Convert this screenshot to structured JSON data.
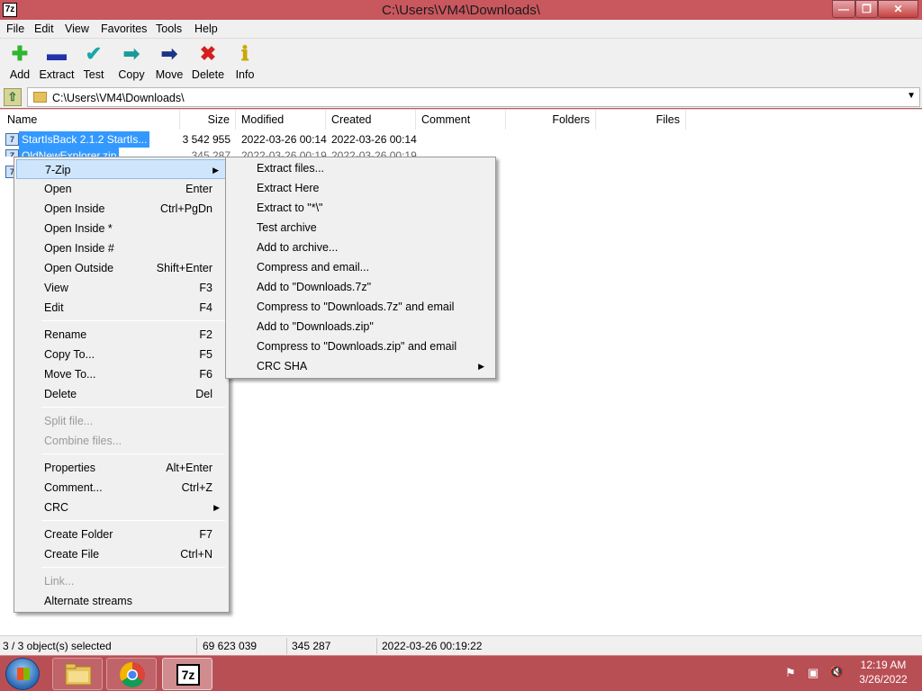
{
  "window": {
    "icon_label": "7z",
    "title": "C:\\Users\\VM4\\Downloads\\",
    "min_icon": "minimize-icon",
    "max_icon": "restore-icon",
    "close_icon": "close-icon",
    "min_glyph": "—",
    "max_glyph": "❐",
    "close_glyph": "✕"
  },
  "menubar": [
    "File",
    "Edit",
    "View",
    "Favorites",
    "Tools",
    "Help"
  ],
  "toolbar": [
    {
      "label": "Add",
      "icon": "plus-icon",
      "glyph": "✚",
      "color": "#2fb52f"
    },
    {
      "label": "Extract",
      "icon": "minus-icon",
      "glyph": "▬",
      "color": "#2233aa"
    },
    {
      "label": "Test",
      "icon": "check-icon",
      "glyph": "✔",
      "color": "#1aa7a7"
    },
    {
      "label": "Copy",
      "icon": "copy-arrow-icon",
      "glyph": "➡",
      "color": "#1a9a9a"
    },
    {
      "label": "Move",
      "icon": "move-arrow-icon",
      "glyph": "➡",
      "color": "#1a3488"
    },
    {
      "label": "Delete",
      "icon": "delete-x-icon",
      "glyph": "✖",
      "color": "#d42020"
    },
    {
      "label": "Info",
      "icon": "info-icon",
      "glyph": "ℹ",
      "color": "#c8a800"
    }
  ],
  "address": {
    "path": "C:\\Users\\VM4\\Downloads\\",
    "up_glyph": "⇧",
    "drop_glyph": "▼"
  },
  "columns": [
    "Name",
    "Size",
    "Modified",
    "Created",
    "Comment",
    "Folders",
    "Files"
  ],
  "files": [
    {
      "name": "StartIsBack 2.1.2  StartIs...",
      "size": "3 542 955",
      "modified": "2022-03-26 00:14",
      "created": "2022-03-26 00:14",
      "icon": "7z-archive-icon",
      "icon_glyph": "7"
    },
    {
      "name": "OldNewExplorer.zip",
      "size": "345 287",
      "modified": "2022-03-26 00:19",
      "created": "2022-03-26 00:19",
      "icon": "zip-archive-icon",
      "icon_glyph": "Z"
    },
    {
      "name": "",
      "size": "",
      "modified": "",
      "created": "",
      "icon": "archive-icon",
      "icon_glyph": "7"
    }
  ],
  "context_menu": {
    "items": [
      {
        "label": "7-Zip",
        "key": "",
        "submenu": true,
        "highlight": true
      },
      {
        "label": "Open",
        "key": "Enter"
      },
      {
        "label": "Open Inside",
        "key": "Ctrl+PgDn"
      },
      {
        "label": "Open Inside *",
        "key": ""
      },
      {
        "label": "Open Inside #",
        "key": ""
      },
      {
        "label": "Open Outside",
        "key": "Shift+Enter"
      },
      {
        "label": "View",
        "key": "F3"
      },
      {
        "label": "Edit",
        "key": "F4"
      },
      {
        "sep": true
      },
      {
        "label": "Rename",
        "key": "F2"
      },
      {
        "label": "Copy To...",
        "key": "F5"
      },
      {
        "label": "Move To...",
        "key": "F6"
      },
      {
        "label": "Delete",
        "key": "Del"
      },
      {
        "sep": true
      },
      {
        "label": "Split file...",
        "key": "",
        "disabled": true
      },
      {
        "label": "Combine files...",
        "key": "",
        "disabled": true
      },
      {
        "sep": true
      },
      {
        "label": "Properties",
        "key": "Alt+Enter"
      },
      {
        "label": "Comment...",
        "key": "Ctrl+Z"
      },
      {
        "label": "CRC",
        "key": "",
        "submenu": true
      },
      {
        "sep": true
      },
      {
        "label": "Create Folder",
        "key": "F7"
      },
      {
        "label": "Create File",
        "key": "Ctrl+N"
      },
      {
        "sep": true
      },
      {
        "label": "Link...",
        "key": "",
        "disabled": true
      },
      {
        "label": "Alternate streams",
        "key": ""
      }
    ],
    "submenu_glyph": "▶"
  },
  "submenu": [
    {
      "label": "Extract files..."
    },
    {
      "label": "Extract Here"
    },
    {
      "label": "Extract to \"*\\\""
    },
    {
      "label": "Test archive"
    },
    {
      "label": "Add to archive..."
    },
    {
      "label": "Compress and email..."
    },
    {
      "label": "Add to \"Downloads.7z\""
    },
    {
      "label": "Compress to \"Downloads.7z\" and email"
    },
    {
      "label": "Add to \"Downloads.zip\""
    },
    {
      "label": "Compress to \"Downloads.zip\" and email"
    },
    {
      "label": "CRC SHA",
      "submenu": true
    }
  ],
  "status": {
    "selected": "3 / 3 object(s) selected",
    "total_size": "69 623 039",
    "item_size": "345 287",
    "date": "2022-03-26 00:19:22"
  },
  "taskbar": {
    "apps": [
      {
        "name": "file-explorer-icon"
      },
      {
        "name": "chrome-icon"
      },
      {
        "name": "7zip-icon",
        "label": "7z",
        "active": true
      }
    ],
    "time": "12:19 AM",
    "date": "3/26/2022",
    "tray_icons": [
      "action-center-flag-icon",
      "network-icon",
      "volume-muted-icon"
    ],
    "tray_glyphs": [
      "⚑",
      "▣",
      "🔇"
    ]
  }
}
